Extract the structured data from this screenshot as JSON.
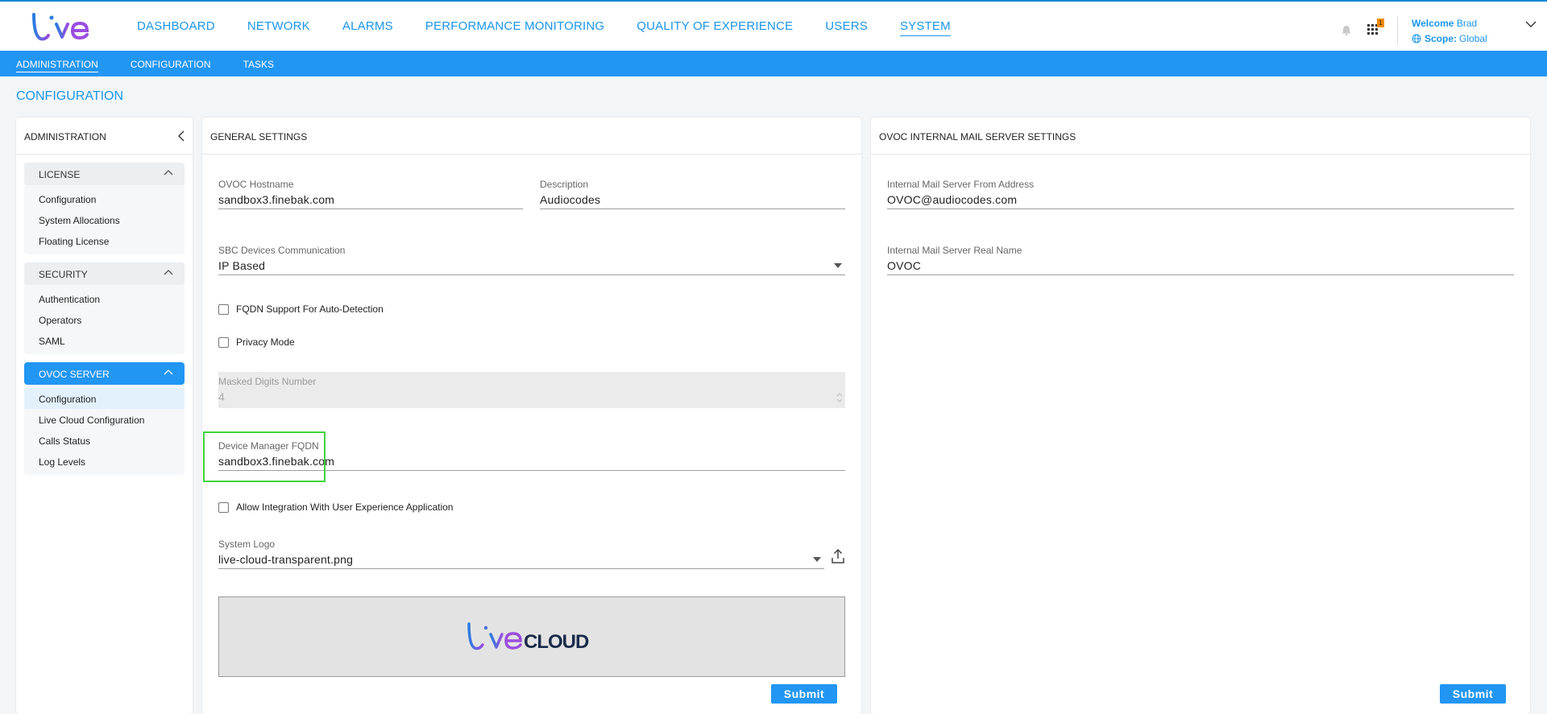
{
  "brand": {
    "logo_text": "live"
  },
  "nav": {
    "items": [
      {
        "label": "DASHBOARD"
      },
      {
        "label": "NETWORK"
      },
      {
        "label": "ALARMS"
      },
      {
        "label": "PERFORMANCE MONITORING"
      },
      {
        "label": "QUALITY OF EXPERIENCE"
      },
      {
        "label": "USERS"
      },
      {
        "label": "SYSTEM"
      }
    ],
    "active": "SYSTEM",
    "alarm_count": "1"
  },
  "user": {
    "welcome_label": "Welcome",
    "name": "Brad",
    "scope_label": "Scope:",
    "scope_value": "Global"
  },
  "subnav": {
    "items": [
      {
        "label": "ADMINISTRATION"
      },
      {
        "label": "CONFIGURATION"
      },
      {
        "label": "TASKS"
      }
    ]
  },
  "page": {
    "title": "CONFIGURATION"
  },
  "sidebar": {
    "title": "ADMINISTRATION",
    "groups": [
      {
        "label": "LICENSE",
        "items": [
          "Configuration",
          "System Allocations",
          "Floating License"
        ]
      },
      {
        "label": "SECURITY",
        "items": [
          "Authentication",
          "Operators",
          "SAML"
        ]
      },
      {
        "label": "OVOC SERVER",
        "items": [
          "Configuration",
          "Live Cloud Configuration",
          "Calls Status",
          "Log Levels"
        ]
      }
    ]
  },
  "general": {
    "title": "GENERAL SETTINGS",
    "hostname_label": "OVOC Hostname",
    "hostname_value": "sandbox3.finebak.com",
    "description_label": "Description",
    "description_value": "Audiocodes",
    "sbc_label": "SBC Devices Communication",
    "sbc_value": "IP Based",
    "fqdn_checkbox_label": "FQDN Support For Auto-Detection",
    "privacy_checkbox_label": "Privacy Mode",
    "masked_label": "Masked Digits Number",
    "masked_value": "4",
    "device_manager_label": "Device Manager FQDN",
    "device_manager_value": "sandbox3.finebak.com",
    "integration_checkbox_label": "Allow Integration With User Experience Application",
    "logo_label": "System Logo",
    "logo_value": "live-cloud-transparent.png",
    "preview_logo_live": "live",
    "preview_logo_cloud": "CLOUD",
    "submit_label": "Submit"
  },
  "mail": {
    "title": "OVOC INTERNAL MAIL SERVER SETTINGS",
    "from_label": "Internal Mail Server From Address",
    "from_value": "OVOC@audiocodes.com",
    "realname_label": "Internal Mail Server Real Name",
    "realname_value": "OVOC",
    "submit_label": "Submit"
  },
  "colors": {
    "primary": "#2196f3",
    "link": "#1b95e8",
    "highlight": "#3ed53a",
    "badge": "#f08a00"
  }
}
